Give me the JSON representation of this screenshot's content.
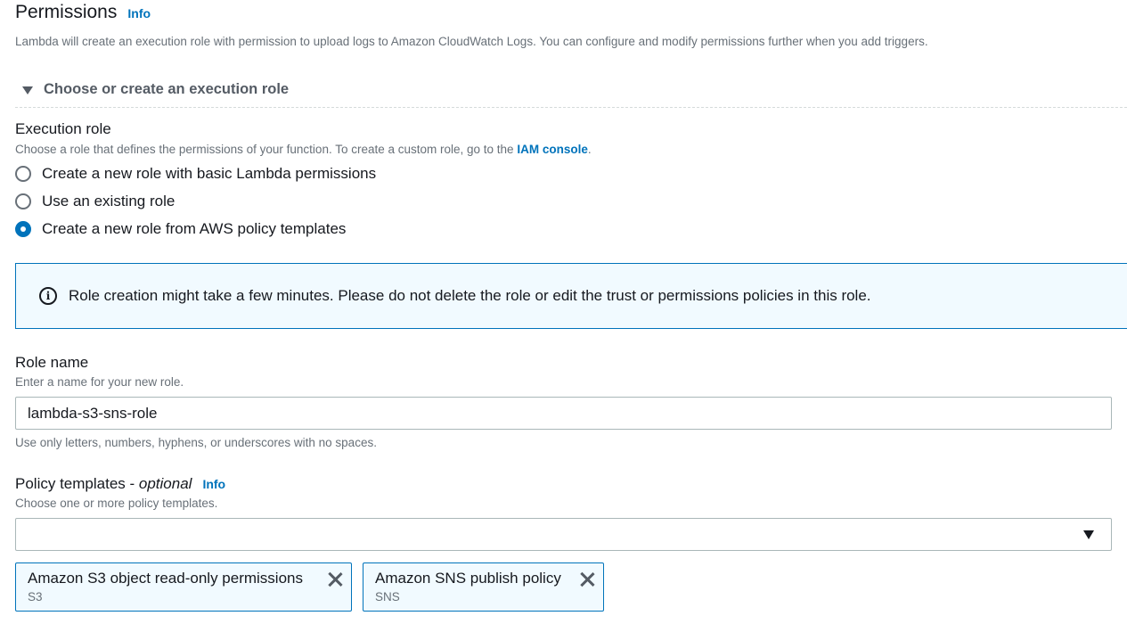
{
  "permissions": {
    "title": "Permissions",
    "info_label": "Info",
    "description": "Lambda will create an execution role with permission to upload logs to Amazon CloudWatch Logs. You can configure and modify permissions further when you add triggers."
  },
  "expander": {
    "label": "Choose or create an execution role",
    "expanded": true
  },
  "execution_role": {
    "label": "Execution role",
    "description_prefix": "Choose a role that defines the permissions of your function. To create a custom role, go to the ",
    "description_link": "IAM console",
    "description_suffix": ".",
    "options": [
      {
        "label": "Create a new role with basic Lambda permissions",
        "selected": false
      },
      {
        "label": "Use an existing role",
        "selected": false
      },
      {
        "label": "Create a new role from AWS policy templates",
        "selected": true
      }
    ]
  },
  "alert": {
    "icon": "info-circle-icon",
    "message": "Role creation might take a few minutes. Please do not delete the role or edit the trust or permissions policies in this role."
  },
  "role_name": {
    "label": "Role name",
    "description": "Enter a name for your new role.",
    "value": "lambda-s3-sns-role",
    "constraint": "Use only letters, numbers, hyphens, or underscores with no spaces."
  },
  "policy_templates": {
    "label": "Policy templates - ",
    "label_optional": "optional",
    "info_label": "Info",
    "description": "Choose one or more policy templates.",
    "selected": [
      {
        "name": "Amazon S3 object read-only permissions",
        "tag": "S3"
      },
      {
        "name": "Amazon SNS publish policy",
        "tag": "SNS"
      }
    ]
  },
  "colors": {
    "link": "#0073bb",
    "alert_border": "#0073bb",
    "alert_background": "#f1faff",
    "text": "#16191f",
    "muted": "#687078"
  }
}
